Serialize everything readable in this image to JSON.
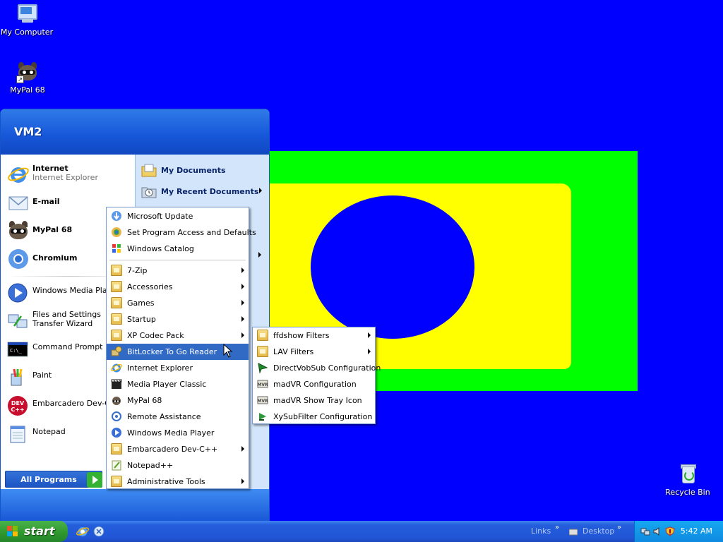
{
  "desktop": {
    "icons": [
      {
        "label": "My Computer"
      },
      {
        "label": "MyPal 68"
      },
      {
        "label": "Recycle Bin"
      }
    ],
    "colors": {
      "background": "#0000fe",
      "green": "#00ff00",
      "yellow": "#ffff00"
    }
  },
  "start_menu": {
    "user": "VM2",
    "pinned": [
      {
        "title": "Internet",
        "subtitle": "Internet Explorer"
      },
      {
        "title": "E-mail"
      },
      {
        "title": "MyPal 68"
      },
      {
        "title": "Chromium"
      }
    ],
    "frequent": [
      "Windows Media Player",
      "Files and Settings Transfer Wizard",
      "Command Prompt",
      "Paint",
      "Embarcadero Dev-C++",
      "Notepad"
    ],
    "right": [
      {
        "label": "My Documents"
      },
      {
        "label": "My Recent Documents"
      }
    ],
    "all_programs": "All Programs"
  },
  "programs_menu": {
    "top_items": [
      "Microsoft Update",
      "Set Program Access and Defaults",
      "Windows Catalog"
    ],
    "items": [
      {
        "label": "7-Zip",
        "submenu": true
      },
      {
        "label": "Accessories",
        "submenu": true
      },
      {
        "label": "Games",
        "submenu": true
      },
      {
        "label": "Startup",
        "submenu": true
      },
      {
        "label": "XP Codec Pack",
        "submenu": true
      },
      {
        "label": "BitLocker To Go Reader",
        "submenu": false
      },
      {
        "label": "Internet Explorer",
        "submenu": false
      },
      {
        "label": "Media Player Classic",
        "submenu": false
      },
      {
        "label": "MyPal 68",
        "submenu": false
      },
      {
        "label": "Remote Assistance",
        "submenu": false
      },
      {
        "label": "Windows Media Player",
        "submenu": false
      },
      {
        "label": "Embarcadero Dev-C++",
        "submenu": true
      },
      {
        "label": "Notepad++",
        "submenu": false
      },
      {
        "label": "Administrative Tools",
        "submenu": true
      }
    ]
  },
  "codec_menu": {
    "items": [
      {
        "label": "ffdshow Filters",
        "submenu": true
      },
      {
        "label": "LAV Filters",
        "submenu": true
      },
      {
        "label": "DirectVobSub Configuration",
        "submenu": false
      },
      {
        "label": "madVR Configuration",
        "submenu": false
      },
      {
        "label": "madVR Show Tray Icon",
        "submenu": false
      },
      {
        "label": "XySubFilter Configuration",
        "submenu": false
      }
    ]
  },
  "taskbar": {
    "start": "start",
    "links": "Links",
    "desktop": "Desktop",
    "chevron": "»",
    "clock": "5:42 AM"
  }
}
